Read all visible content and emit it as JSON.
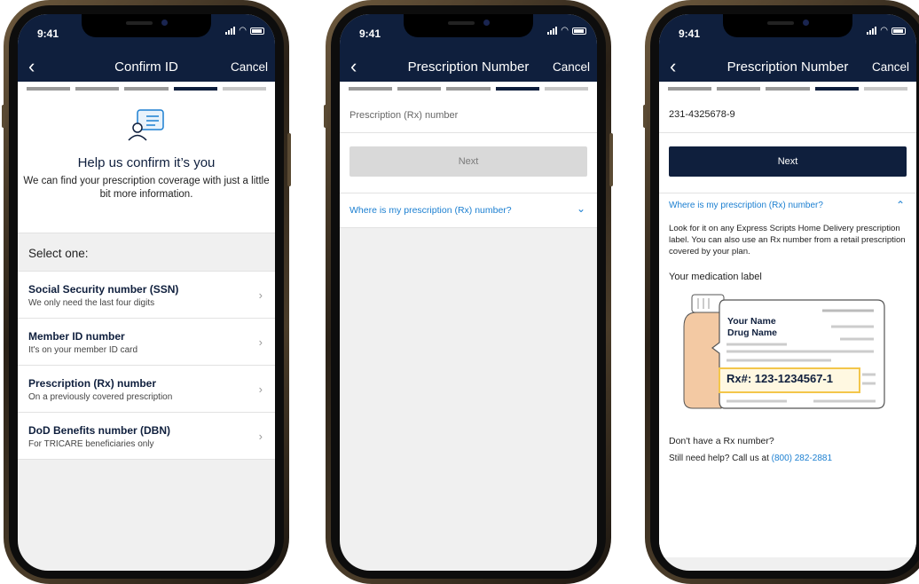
{
  "status": {
    "time": "9:41"
  },
  "screen1": {
    "nav": {
      "title": "Confirm ID",
      "cancel": "Cancel"
    },
    "icon": "id-card-person-icon",
    "heading": "Help us confirm it’s you",
    "subtext": "We can find your prescription coverage with just a little bit more information.",
    "select_label": "Select one:",
    "options": [
      {
        "title": "Social Security number (SSN)",
        "subtitle": "We only need the last four digits"
      },
      {
        "title": "Member ID number",
        "subtitle": "It's on your member ID card"
      },
      {
        "title": "Prescription (Rx) number",
        "subtitle": "On a previously covered prescription"
      },
      {
        "title": "DoD Benefits number (DBN)",
        "subtitle": "For TRICARE beneficiaries only"
      }
    ]
  },
  "screen2": {
    "nav": {
      "title": "Prescription Number",
      "cancel": "Cancel"
    },
    "input": {
      "placeholder": "Prescription (Rx) number",
      "value": ""
    },
    "next": "Next",
    "help_link": "Where is my prescription (Rx) number?"
  },
  "screen3": {
    "nav": {
      "title": "Prescription Number",
      "cancel": "Cancel"
    },
    "input": {
      "value": "231-4325678-9"
    },
    "next": "Next",
    "help_link": "Where is my prescription (Rx) number?",
    "help_text": "Look for it on any Express Scripts Home Delivery prescription label. You can also use an Rx number from a retail prescription covered by your plan.",
    "label_heading": "Your medication label",
    "label": {
      "name": "Your Name",
      "drug": "Drug Name",
      "rx": "Rx#: 123-1234567-1"
    },
    "no_rx": "Don't have a Rx number?",
    "help_prefix": "Still need help? Call us at ",
    "phone": "(800) 282-2881"
  },
  "colors": {
    "navy": "#0f1f3d",
    "link": "#1b7fd1",
    "highlight": "#f3c64a",
    "bottle": "#f3c9a3"
  }
}
